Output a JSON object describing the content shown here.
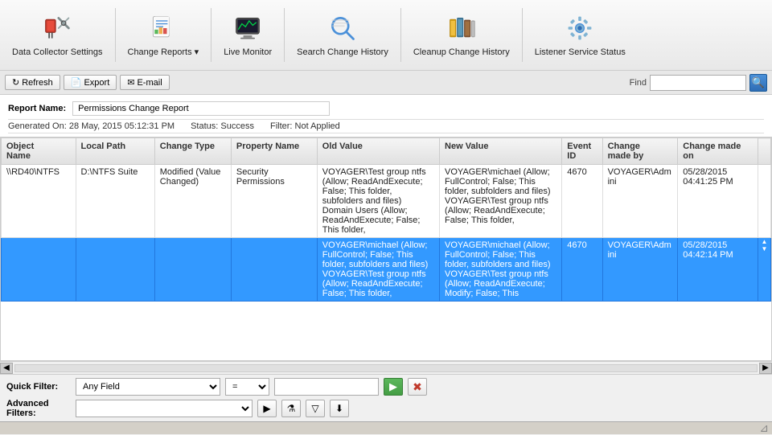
{
  "toolbar": {
    "buttons": [
      {
        "id": "data-collector-settings",
        "label": "Data Collector\nSettings",
        "icon": "settings"
      },
      {
        "id": "change-reports",
        "label": "Change\nReports",
        "icon": "reports",
        "has_dropdown": true
      },
      {
        "id": "live-monitor",
        "label": "Live\nMonitor",
        "icon": "monitor"
      },
      {
        "id": "search-change-history",
        "label": "Search\nChange History",
        "icon": "search"
      },
      {
        "id": "cleanup-change-history",
        "label": "Cleanup\nChange History",
        "icon": "cleanup"
      },
      {
        "id": "listener-service-status",
        "label": "Listener\nService Status",
        "icon": "listener"
      }
    ]
  },
  "action_bar": {
    "refresh_label": "Refresh",
    "export_label": "Export",
    "email_label": "E-mail",
    "find_label": "Find"
  },
  "report": {
    "name_label": "Report Name:",
    "name_value": "Permissions Change Report",
    "generated_on": "Generated On: 28 May, 2015 05:12:31 PM",
    "status": "Status: Success",
    "filter": "Filter: Not Applied"
  },
  "table": {
    "columns": [
      {
        "id": "object-name",
        "label": "Object\nName"
      },
      {
        "id": "local-path",
        "label": "Local Path"
      },
      {
        "id": "change-type",
        "label": "Change Type"
      },
      {
        "id": "property-name",
        "label": "Property Name"
      },
      {
        "id": "old-value",
        "label": "Old Value"
      },
      {
        "id": "new-value",
        "label": "New Value"
      },
      {
        "id": "event-id",
        "label": "Event\nID"
      },
      {
        "id": "change-made-by",
        "label": "Change\nmade by"
      },
      {
        "id": "change-made-on",
        "label": "Change made\non"
      }
    ],
    "rows": [
      {
        "selected": false,
        "object_name": "\\\\RD40\\NTFS",
        "local_path": "D:\\NTFS Suite",
        "change_type": "Modified (Value Changed)",
        "property_name": "Security Permissions",
        "old_value": "VOYAGER\\Test group ntfs (Allow; ReadAndExecute; False; This folder, subfolders and files) Domain Users (Allow; ReadAndExecute; False; This folder,",
        "new_value": "VOYAGER\\michael (Allow; FullControl; False; This folder, subfolders and files) VOYAGER\\Test group ntfs (Allow; ReadAndExecute; False; This folder,",
        "event_id": "4670",
        "change_made_by": "VOYAGER\\Admini",
        "change_made_on": "05/28/2015\n04:41:25 PM"
      },
      {
        "selected": true,
        "object_name": "",
        "local_path": "",
        "change_type": "",
        "property_name": "",
        "old_value": "VOYAGER\\michael (Allow; FullControl; False; This folder, subfolders and files) VOYAGER\\Test group ntfs (Allow; ReadAndExecute; False; This folder,",
        "new_value": "VOYAGER\\michael (Allow; FullControl; False; This folder, subfolders and files) VOYAGER\\Test group ntfs (Allow; ReadAndExecute; Modify; False; This",
        "event_id": "4670",
        "change_made_by": "VOYAGER\\Admini",
        "change_made_on": "05/28/2015\n04:42:14 PM"
      }
    ]
  },
  "quick_filter": {
    "label": "Quick Filter:",
    "field_label": "Any Field",
    "operator_label": "=",
    "value_placeholder": ""
  },
  "advanced_filter": {
    "label": "Advanced Filters:",
    "value": ""
  }
}
